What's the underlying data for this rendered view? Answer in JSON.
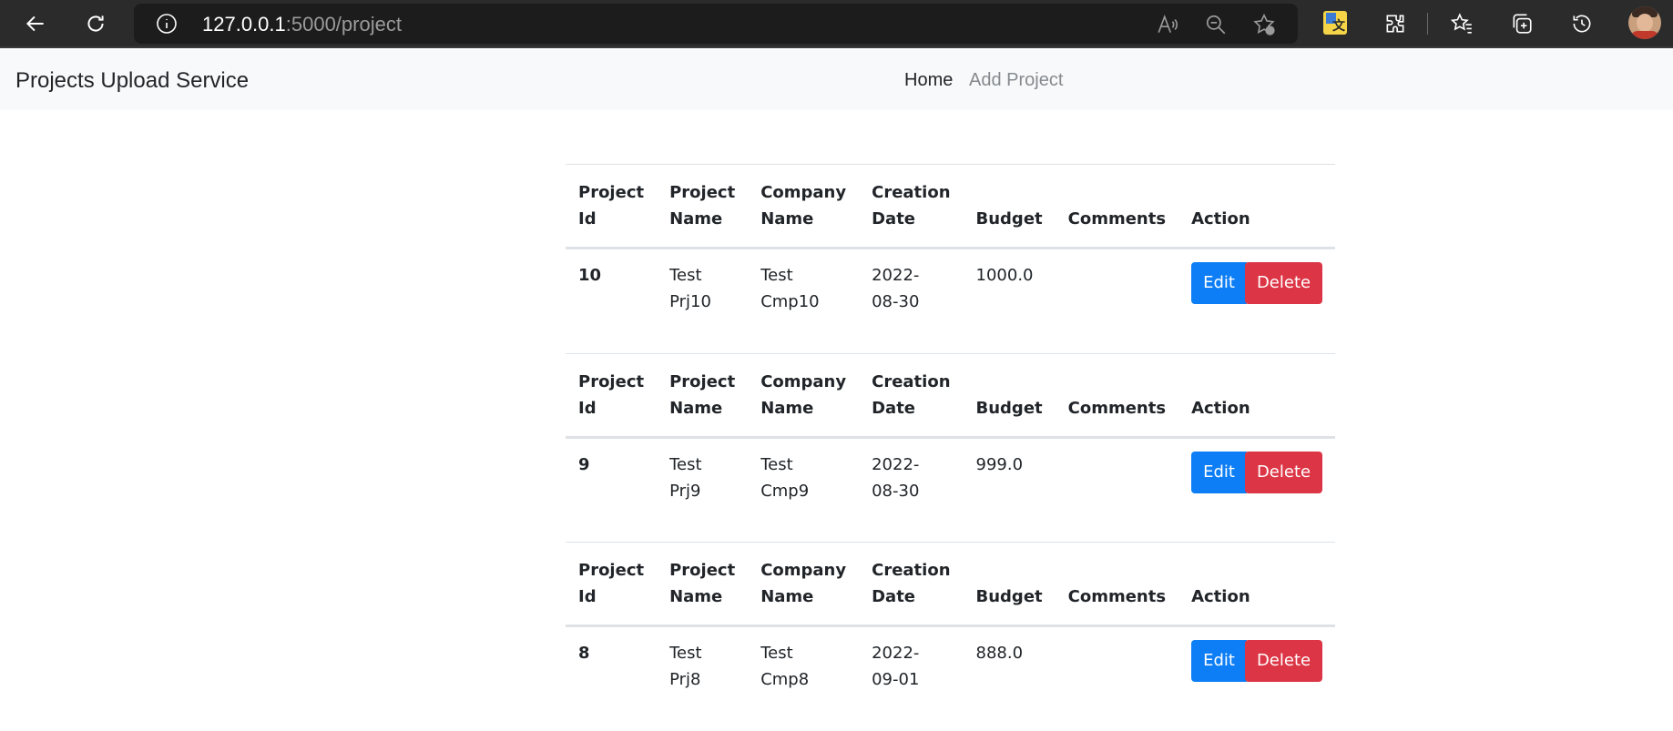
{
  "browser": {
    "url_host": "127.0.0.1",
    "url_rest": ":5000/project"
  },
  "navbar": {
    "brand": "Projects Upload Service",
    "links": [
      {
        "label": "Home",
        "active": true
      },
      {
        "label": "Add Project",
        "active": false
      }
    ]
  },
  "table": {
    "headers": {
      "project_id": [
        "Project",
        "Id"
      ],
      "project_name": [
        "Project",
        "Name"
      ],
      "company_name": [
        "Company",
        "Name"
      ],
      "creation_date": [
        "Creation",
        "Date"
      ],
      "budget": "Budget",
      "comments": "Comments",
      "action": "Action"
    },
    "rows": [
      {
        "id": "10",
        "name": [
          "Test",
          "Prj10"
        ],
        "company": [
          "Test",
          "Cmp10"
        ],
        "date": [
          "2022-",
          "08-30"
        ],
        "budget": "1000.0",
        "comments": ""
      },
      {
        "id": "9",
        "name": [
          "Test",
          "Prj9"
        ],
        "company": [
          "Test",
          "Cmp9"
        ],
        "date": [
          "2022-",
          "08-30"
        ],
        "budget": "999.0",
        "comments": ""
      },
      {
        "id": "8",
        "name": [
          "Test",
          "Prj8"
        ],
        "company": [
          "Test",
          "Cmp8"
        ],
        "date": [
          "2022-",
          "09-01"
        ],
        "budget": "888.0",
        "comments": ""
      }
    ],
    "edit_label": "Edit",
    "delete_label": "Delete"
  },
  "colors": {
    "edit": "#0d7ef5",
    "delete": "#dc3545",
    "navbar_bg": "#f8f9fa"
  },
  "icons": [
    "back-icon",
    "refresh-icon",
    "info-icon",
    "read-aloud-icon",
    "zoom-out-icon",
    "add-favorite-icon",
    "translate-icon",
    "extensions-icon",
    "favorites-icon",
    "collections-icon",
    "history-icon",
    "profile-avatar"
  ]
}
